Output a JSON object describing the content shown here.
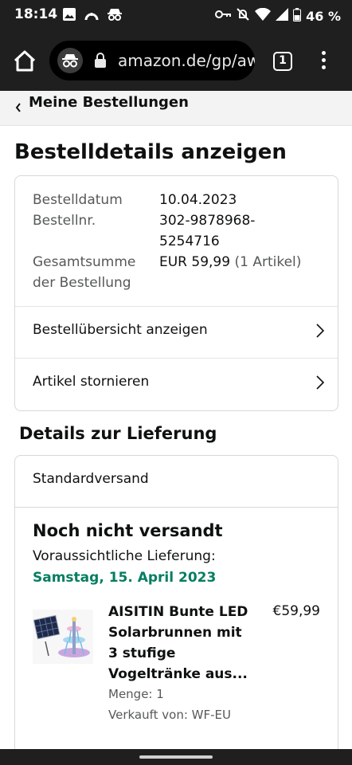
{
  "status_bar": {
    "time": "18:14",
    "battery": "46 %",
    "left_icons": [
      "image-icon",
      "arc-icon",
      "incognito-icon"
    ],
    "right_icons": [
      "key-icon",
      "mute-icon",
      "wifi-icon",
      "signal-icon",
      "battery-icon"
    ]
  },
  "browser": {
    "url": "amazon.de/gp/aw",
    "tab_count": "1"
  },
  "subnav": {
    "back_label": "Meine Bestellungen"
  },
  "page": {
    "title": "Bestelldetails anzeigen"
  },
  "order_summary": {
    "date_label": "Bestelldatum",
    "date_value": "10.04.2023",
    "number_label": "Bestellnr.",
    "number_value_line1": "302-9878968-",
    "number_value_line2": "5254716",
    "total_label_line1": "Gesamtsumme",
    "total_label_line2": "der Bestellung",
    "total_value": "EUR 59,99",
    "total_items": "(1 Artikel)",
    "rows": [
      {
        "label": "Bestellübersicht anzeigen"
      },
      {
        "label": "Artikel stornieren"
      }
    ]
  },
  "delivery": {
    "section_title": "Details zur Lieferung",
    "method": "Standardversand",
    "status": "Noch nicht versandt",
    "expected_label": "Voraussichtliche Lieferung:",
    "expected_date": "Samstag, 15. April 2023",
    "colors": {
      "date": "#067d62"
    },
    "item": {
      "title": "AISITIN Bunte LED Solarbrunnen mit 3 stufige Vogeltränke aus...",
      "price": "€59,99",
      "quantity": "Menge: 1",
      "seller": "Verkauft von: WF-EU"
    }
  }
}
